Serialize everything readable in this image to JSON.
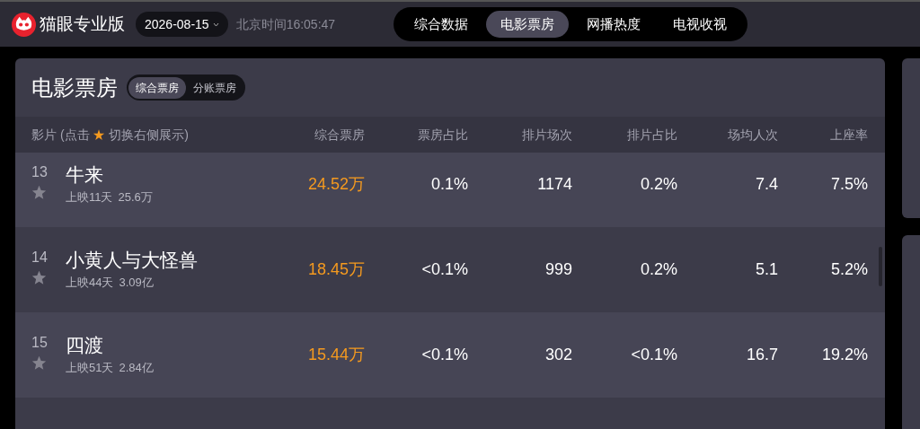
{
  "header": {
    "brand": "猫眼专业版",
    "date": "2026-08-15",
    "time": "北京时间16:05:47"
  },
  "nav_tabs": [
    {
      "label": "综合数据",
      "selected": false
    },
    {
      "label": "电影票房",
      "selected": true
    },
    {
      "label": "网播热度",
      "selected": false
    },
    {
      "label": "电视收视",
      "selected": false
    }
  ],
  "panel": {
    "title": "电影票房",
    "segments": [
      {
        "label": "综合票房",
        "selected": true
      },
      {
        "label": "分账票房",
        "selected": false
      }
    ],
    "film_header": "影片 (点击 ★ 切换右侧展示)",
    "columns": [
      "综合票房",
      "票房占比",
      "排片场次",
      "排片占比",
      "场均人次",
      "上座率"
    ],
    "rows": [
      {
        "rank": "13",
        "title": "牛来",
        "days": "上映11天",
        "total": "25.6万",
        "starred": false,
        "values": [
          "24.52万",
          "0.1%",
          "1174",
          "0.2%",
          "7.4",
          "7.5%"
        ]
      },
      {
        "rank": "14",
        "title": "小黄人与大怪兽",
        "days": "上映44天",
        "total": "3.09亿",
        "starred": false,
        "values": [
          "18.45万",
          "<0.1%",
          "999",
          "0.2%",
          "5.1",
          "5.2%"
        ]
      },
      {
        "rank": "15",
        "title": "四渡",
        "days": "上映51天",
        "total": "2.84亿",
        "starred": false,
        "values": [
          "15.44万",
          "<0.1%",
          "302",
          "<0.1%",
          "16.7",
          "19.2%"
        ]
      }
    ]
  }
}
